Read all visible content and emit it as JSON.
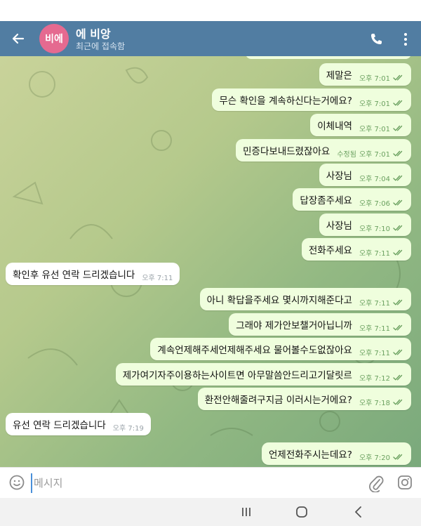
{
  "header": {
    "avatar_initials": "비에",
    "contact_name": "에 비앙",
    "contact_status": "최근에 접속함",
    "back_icon": "arrow-left-icon",
    "call_icon": "phone-icon",
    "menu_icon": "more-vertical-icon",
    "background_color": "#517da2",
    "avatar_color": "#e56a90"
  },
  "messages": [
    {
      "dir": "out",
      "text": "제말은",
      "time": "오후 7:01",
      "edited": ""
    },
    {
      "dir": "out",
      "text": "무슨 확인을 계속하신다는거에요?",
      "time": "오후 7:01",
      "edited": ""
    },
    {
      "dir": "out",
      "text": "이체내역",
      "time": "오후 7:01",
      "edited": ""
    },
    {
      "dir": "out",
      "text": "민증다보내드렸잖아요",
      "time": "오후 7:01",
      "edited": "수정됨"
    },
    {
      "dir": "out",
      "text": "사장님",
      "time": "오후 7:04",
      "edited": ""
    },
    {
      "dir": "out",
      "text": "답장좀주세요",
      "time": "오후 7:06",
      "edited": ""
    },
    {
      "dir": "out",
      "text": "사장님",
      "time": "오후 7:10",
      "edited": ""
    },
    {
      "dir": "out",
      "text": "전화주세요",
      "time": "오후 7:11",
      "edited": ""
    },
    {
      "dir": "in",
      "text": "확인후 유선 연락 드리겠습니다",
      "time": "오후 7:11",
      "edited": ""
    },
    {
      "dir": "out",
      "text": "아니 확답을주세요 몇시까지해준다고",
      "time": "오후 7:11",
      "edited": ""
    },
    {
      "dir": "out",
      "text": "그래야 제가안보챌거아닙니까",
      "time": "오후 7:11",
      "edited": ""
    },
    {
      "dir": "out",
      "text": "계속언제해주세언제해주세요 물어볼수도없잖아요",
      "time": "오후 7:11",
      "edited": ""
    },
    {
      "dir": "out",
      "text": "제가여기자주이용하는사이트면 아무말씀안드리고기달릿르",
      "time": "오후 7:12",
      "edited": ""
    },
    {
      "dir": "out",
      "text": "환전안해줄려구지금 이러시는거에요?",
      "time": "오후 7:18",
      "edited": ""
    },
    {
      "dir": "in",
      "text": "유선 연락 드리겠습니다",
      "time": "오후 7:19",
      "edited": ""
    },
    {
      "dir": "out",
      "text": "언제전화주시는데요?",
      "time": "오후 7:20",
      "edited": ""
    }
  ],
  "input_bar": {
    "placeholder": "메시지",
    "emoji_icon": "smile-icon",
    "attach_icon": "paperclip-icon",
    "camera_icon": "camera-icon"
  },
  "nav_bar": {
    "recents_icon": "recents-icon",
    "home_icon": "home-icon",
    "back_icon": "nav-back-icon"
  },
  "colors": {
    "outgoing_bubble": "#effedd",
    "incoming_bubble": "#ffffff",
    "read_ticks": "#6aa05f"
  }
}
